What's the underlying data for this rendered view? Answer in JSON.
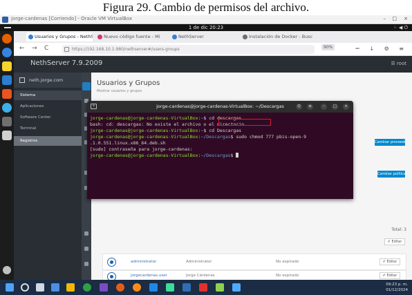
{
  "caption": "Figura 29. Cambio de permisos del archivo.",
  "vbox": {
    "title": "jorge-cardenas [Corriendo] - Oracle VM VirtualBox",
    "controls": [
      "–",
      "□",
      "×"
    ]
  },
  "guest": {
    "clock": "1 de dic  20:23",
    "tray": "⁘ ◀ ⏻"
  },
  "browser": {
    "tabs": [
      {
        "label": "Usuarios y Grupos - NethServer",
        "active": true,
        "fav_color": "#3b7ed0"
      },
      {
        "label": "Nuevo código fuente - Mi",
        "active": false,
        "fav_color": "#d6336c"
      },
      {
        "label": "NethServer",
        "active": false,
        "fav_color": "#3b7ed0"
      },
      {
        "label": "Instalación de Docker - Buscar",
        "active": false,
        "fav_color": "#6c6c6c"
      }
    ],
    "nav": {
      "back": "←",
      "forward": "→",
      "reload": "C"
    },
    "url": "https://192.168.10.1:980/nethserver#/users-groups",
    "zoom": "90%",
    "toolbar_icons": "⭲ ↓ ⚙ ≡"
  },
  "nethserver": {
    "brand": "NethServer 7.9.2009",
    "user_label": "☰ root",
    "host": "neth.jorge.com",
    "nav": [
      {
        "label": "Sistema",
        "state": "active"
      },
      {
        "label": "Aplicaciones",
        "state": "normal"
      },
      {
        "label": "Software Center",
        "state": "normal"
      },
      {
        "label": "Terminal",
        "state": "normal"
      },
      {
        "label": "Registros",
        "state": "highlight"
      }
    ],
    "page_title": "Usuarios y Grupos",
    "page_subtitle": "Mostrar usuarios y grupos",
    "provider_button": "Cambiar proveedor",
    "create_user_button": "Cambiar política",
    "total_label": "Total: 3",
    "filter_label": "✐ Editar",
    "rows": [
      {
        "name": "administrator",
        "full": "Administrator",
        "expiry": "No expirado",
        "action": "✐ Editar"
      },
      {
        "name": "jorgecardenas.user",
        "full": "Jorge Cárdenas",
        "expiry": "No expirado",
        "action": "✐ Editar"
      }
    ]
  },
  "terminal": {
    "title": "jorge-cardenas@jorge-cardenas-VirtualBox: ~/Descargas",
    "newtab": "+",
    "controls": [
      "Q",
      "≡",
      "–",
      "□",
      "×"
    ],
    "lines": [
      {
        "user": "jorge-cardenas@jorge-cardenas-VirtualBox",
        "path": "~",
        "cmd": "$ cd descargas"
      },
      {
        "text": "bash: cd: descargas: No existe el archivo o el directorio"
      },
      {
        "user": "jorge-cardenas@jorge-cardenas-VirtualBox",
        "path": "~",
        "cmd": "$ cd Descargas"
      },
      {
        "user": "jorge-cardenas@jorge-cardenas-VirtualBox",
        "path": "~/Descargas",
        "cmd": "$ sudo chmod 777 pbis-open-9"
      },
      {
        "text": ".1.0.551.linux.x86_64.deb.sh"
      },
      {
        "text": "[sudo] contraseña para jorge-cardenas:"
      },
      {
        "user": "jorge-cardenas@jorge-cardenas-VirtualBox",
        "path": "~/Descargas",
        "cmd": "$ "
      }
    ],
    "highlight_color": "#e01b1b"
  },
  "taskbar": {
    "time": "09:23 p. m.",
    "date": "01/12/2024",
    "icon_colors": [
      "#3b7ed0",
      "#e0e0e0",
      "#4a90e2",
      "#f2b705",
      "#5b9bd5",
      "#2f9e44",
      "#7a4cc2",
      "#e45d1b",
      "#ff8c1a",
      "#1e88e5",
      "#3ddc97",
      "#2f6fb5",
      "#e03131",
      "#8fd14f",
      "#4dabf7"
    ]
  }
}
